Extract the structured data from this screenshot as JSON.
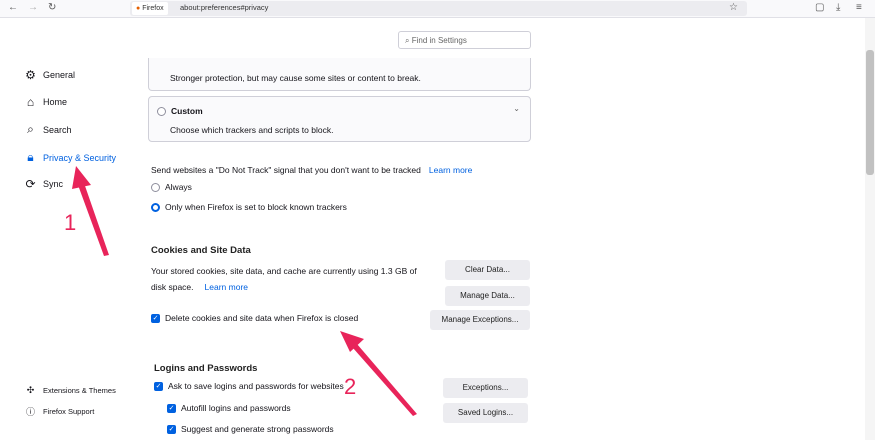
{
  "browser": {
    "tab_label": "Firefox",
    "url": "about:preferences#privacy"
  },
  "search": {
    "placeholder": "Find in Settings"
  },
  "sidebar": {
    "items": [
      {
        "label": "General"
      },
      {
        "label": "Home"
      },
      {
        "label": "Search"
      },
      {
        "label": "Privacy & Security"
      },
      {
        "label": "Sync"
      }
    ],
    "footer": [
      {
        "label": "Extensions & Themes"
      },
      {
        "label": "Firefox Support"
      }
    ]
  },
  "tracking": {
    "strict_desc": "Stronger protection, but may cause some sites or content to break.",
    "custom_label": "Custom",
    "custom_desc": "Choose which trackers and scripts to block."
  },
  "dnt": {
    "text": "Send websites a \"Do Not Track\" signal that you don't want to be tracked",
    "learn_more": "Learn more",
    "always": "Always",
    "only_when": "Only when Firefox is set to block known trackers"
  },
  "cookies": {
    "title": "Cookies and Site Data",
    "desc1": "Your stored cookies, site data, and cache are currently using 1.3 GB of",
    "desc2": "disk space.",
    "learn_more": "Learn more",
    "delete_label": "Delete cookies and site data when Firefox is closed",
    "clear": "Clear Data...",
    "manage": "Manage Data...",
    "exceptions": "Manage Exceptions..."
  },
  "logins": {
    "title": "Logins and Passwords",
    "ask": "Ask to save logins and passwords for websites",
    "autofill": "Autofill logins and passwords",
    "suggest": "Suggest and generate strong passwords",
    "exceptions": "Exceptions...",
    "saved": "Saved Logins..."
  },
  "annotations": {
    "one": "1",
    "two": "2",
    "color": "#e8245a"
  }
}
